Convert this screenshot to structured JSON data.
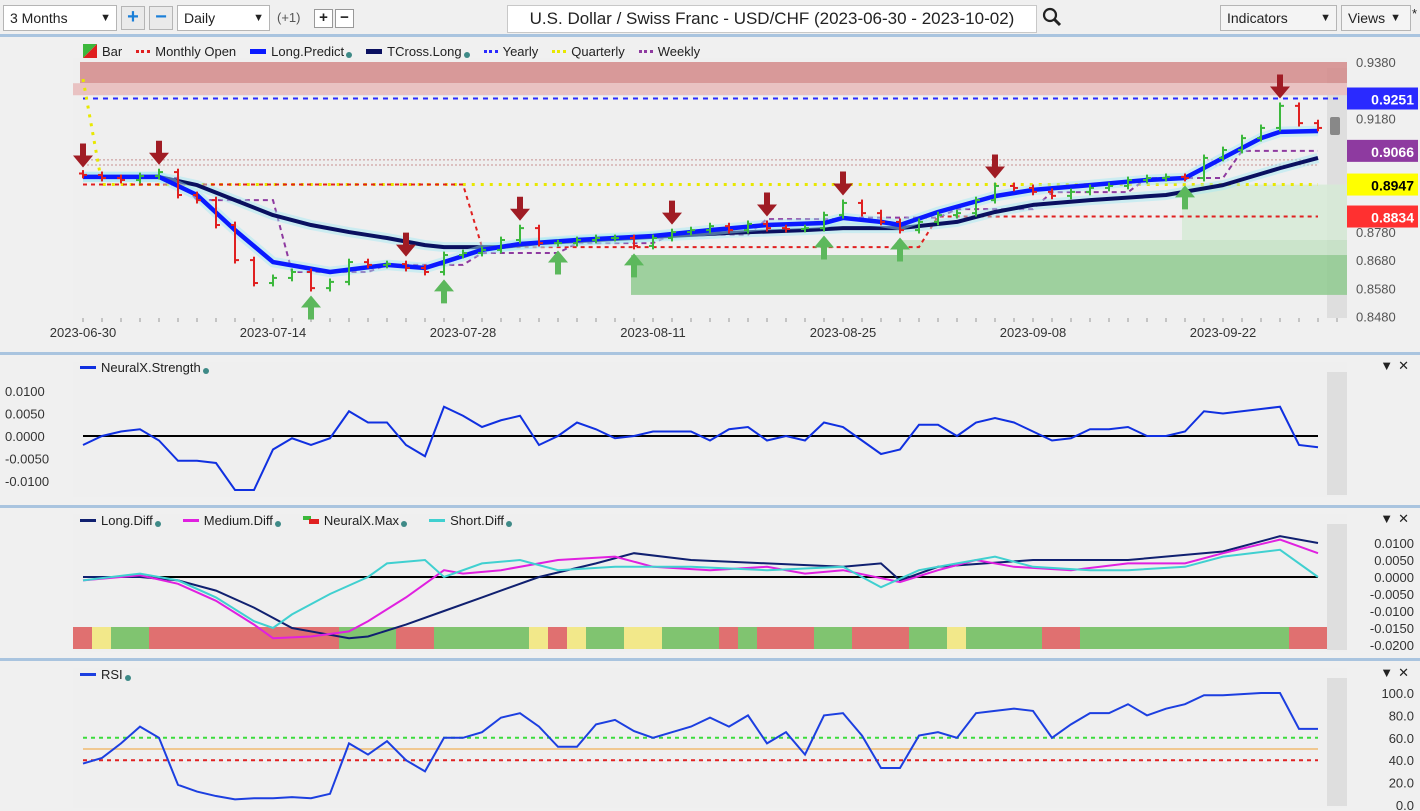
{
  "toolbar": {
    "period": "3 Months",
    "interval": "Daily",
    "offset": "(+1)",
    "title": "U.S. Dollar / Swiss Franc - USD/CHF (2023-06-30 - 2023-10-02)",
    "indicators": "Indicators",
    "views": "Views",
    "views_mark": "*"
  },
  "icons": {
    "zoom_in": "+",
    "zoom_out": "−",
    "search": "search-icon",
    "dropdown": "▼",
    "close": "✕"
  },
  "main_legend": [
    "Bar",
    "Monthly Open",
    "Long.Predict",
    "TCross.Long",
    "Yearly",
    "Quarterly",
    "Weekly"
  ],
  "panel2_legend": [
    "NeuralX.Strength"
  ],
  "panel3_legend": [
    "Long.Diff",
    "Medium.Diff",
    "NeuralX.Max",
    "Short.Diff"
  ],
  "panel4_legend": [
    "RSI"
  ],
  "colors": {
    "up": "#3cb83c",
    "down": "#e02020",
    "long_predict": "#0a1aff",
    "tcross": "#0a1060",
    "yearly": "#2a2aff",
    "quarterly": "#e8e800",
    "weekly": "#8e3aa0",
    "monthly": "#e02020",
    "strength": "#1030e0",
    "long_diff": "#102070",
    "medium_diff": "#e020e0",
    "short_diff": "#40d0d0",
    "rsi": "#1c3fe0"
  },
  "chart_data": [
    {
      "type": "ohlc",
      "frequency": "Daily",
      "x_ticks": [
        "2023-06-30",
        "2023-07-14",
        "2023-07-28",
        "2023-08-11",
        "2023-08-25",
        "2023-09-08",
        "2023-09-22"
      ],
      "ylim": [
        0.848,
        0.938
      ],
      "y_ticks": [
        "0.9380",
        "0.9180",
        "0.8780",
        "0.8680",
        "0.8580",
        "0.8480"
      ],
      "close": [
        0.8981,
        0.897,
        0.8963,
        0.8977,
        0.8991,
        0.891,
        0.8892,
        0.8804,
        0.868,
        0.8599,
        0.8617,
        0.8638,
        0.8581,
        0.8603,
        0.8673,
        0.8663,
        0.8666,
        0.8652,
        0.8638,
        0.8698,
        0.8705,
        0.8716,
        0.8751,
        0.8793,
        0.874,
        0.874,
        0.8751,
        0.8758,
        0.8758,
        0.873,
        0.8758,
        0.8779,
        0.8786,
        0.88,
        0.8786,
        0.8808,
        0.8793,
        0.879,
        0.8793,
        0.8839,
        0.8882,
        0.8846,
        0.8815,
        0.8786,
        0.8815,
        0.8839,
        0.8846,
        0.8892,
        0.8942,
        0.8935,
        0.8921,
        0.8907,
        0.8921,
        0.8935,
        0.8942,
        0.8963,
        0.897,
        0.8974,
        0.897,
        0.9041,
        0.9069,
        0.9111,
        0.9147,
        0.9225,
        0.9164,
        0.9147
      ],
      "long_predict": [
        [
          "2023-06-30",
          0.8974
        ],
        [
          "2023-07-06",
          0.8974
        ],
        [
          "2023-07-10",
          0.891
        ],
        [
          "2023-07-12",
          0.8786
        ],
        [
          "2023-07-14",
          0.8673
        ],
        [
          "2023-07-19",
          0.8638
        ],
        [
          "2023-07-24",
          0.8663
        ],
        [
          "2023-07-26",
          0.8652
        ],
        [
          "2023-07-27",
          0.8673
        ],
        [
          "2023-07-31",
          0.8716
        ],
        [
          "2023-08-02",
          0.8737
        ],
        [
          "2023-08-07",
          0.8751
        ],
        [
          "2023-08-11",
          0.8765
        ],
        [
          "2023-08-16",
          0.8786
        ],
        [
          "2023-08-21",
          0.8804
        ],
        [
          "2023-08-24",
          0.8811
        ],
        [
          "2023-08-25",
          0.8829
        ],
        [
          "2023-08-29",
          0.8815
        ],
        [
          "2023-08-30",
          0.8804
        ],
        [
          "2023-09-01",
          0.885
        ],
        [
          "2023-09-06",
          0.8906
        ],
        [
          "2023-09-08",
          0.8928
        ],
        [
          "2023-09-13",
          0.8945
        ],
        [
          "2023-09-18",
          0.8963
        ],
        [
          "2023-09-20",
          0.897
        ],
        [
          "2023-09-22",
          0.9041
        ],
        [
          "2023-09-26",
          0.9111
        ],
        [
          "2023-09-27",
          0.9133
        ],
        [
          "2023-09-29",
          0.9136
        ]
      ],
      "tcross_long": [
        [
          "2023-06-30",
          0.8974
        ],
        [
          "2023-07-06",
          0.8974
        ],
        [
          "2023-07-10",
          0.8945
        ],
        [
          "2023-07-12",
          0.8892
        ],
        [
          "2023-07-14",
          0.8839
        ],
        [
          "2023-07-18",
          0.8804
        ],
        [
          "2023-07-20",
          0.8779
        ],
        [
          "2023-07-24",
          0.8758
        ],
        [
          "2023-07-26",
          0.8733
        ],
        [
          "2023-07-27",
          0.8726
        ],
        [
          "2023-08-01",
          0.8726
        ],
        [
          "2023-08-03",
          0.874
        ],
        [
          "2023-08-08",
          0.8751
        ],
        [
          "2023-08-11",
          0.8762
        ],
        [
          "2023-08-17",
          0.8776
        ],
        [
          "2023-08-23",
          0.8786
        ],
        [
          "2023-08-25",
          0.8793
        ],
        [
          "2023-08-30",
          0.8793
        ],
        [
          "2023-09-04",
          0.8815
        ],
        [
          "2023-09-06",
          0.885
        ],
        [
          "2023-09-08",
          0.8875
        ],
        [
          "2023-09-13",
          0.8892
        ],
        [
          "2023-09-19",
          0.891
        ],
        [
          "2023-09-22",
          0.8945
        ],
        [
          "2023-09-27",
          0.9005
        ],
        [
          "2023-09-29",
          0.9041
        ]
      ],
      "yearly": 0.9251,
      "quarterly": [
        [
          "2023-06-30",
          0.932
        ],
        [
          "2023-07-03",
          0.8947
        ],
        [
          "2023-09-29",
          0.8947
        ]
      ],
      "monthly_open": [
        [
          "2023-06-30",
          "2023-07-28",
          0.8947
        ],
        [
          "2023-07-31",
          "2023-08-31",
          0.8726
        ],
        [
          "2023-09-01",
          "2023-09-29",
          0.8834
        ]
      ],
      "weekly": [
        [
          "2023-07-03",
          "2023-07-07",
          0.897
        ],
        [
          "2023-07-10",
          "2023-07-14",
          0.8892
        ],
        [
          "2023-07-17",
          "2023-07-21",
          0.8638
        ],
        [
          "2023-07-24",
          "2023-07-28",
          0.8663
        ],
        [
          "2023-07-31",
          "2023-08-04",
          0.8705
        ],
        [
          "2023-08-07",
          "2023-08-11",
          0.874
        ],
        [
          "2023-08-14",
          "2023-08-18",
          0.877
        ],
        [
          "2023-08-21",
          "2023-08-25",
          0.8825
        ],
        [
          "2023-08-28",
          "2023-09-01",
          0.883
        ],
        [
          "2023-09-04",
          "2023-09-08",
          0.886
        ],
        [
          "2023-09-11",
          "2023-09-15",
          0.892
        ],
        [
          "2023-09-18",
          "2023-09-22",
          0.897
        ],
        [
          "2023-09-25",
          "2023-09-29",
          0.9066
        ]
      ],
      "level_labels": [
        {
          "value": "0.9251",
          "color": "#2a2aff",
          "text_color": "#ffffff"
        },
        {
          "value": "0.9066",
          "color": "#8e3aa0",
          "text_color": "#ffffff"
        },
        {
          "value": "0.8947",
          "color": "#ffff00",
          "text_color": "#000000"
        },
        {
          "value": "0.8834",
          "color": "#ff3030",
          "text_color": "#ffffff"
        }
      ],
      "down_signals": [
        "2023-06-30",
        "2023-07-06",
        "2023-07-25",
        "2023-08-02",
        "2023-08-14",
        "2023-08-21",
        "2023-08-25",
        "2023-09-06",
        "2023-09-27"
      ],
      "up_signals": [
        "2023-07-18",
        "2023-07-27",
        "2023-08-04",
        "2023-08-10",
        "2023-08-24",
        "2023-08-30",
        "2023-09-20"
      ],
      "zones": [
        {
          "from": "2023-06-30",
          "low": 0.9305,
          "high": 0.938,
          "color": "#d48a8a"
        },
        {
          "from": "2023-08-10",
          "low": 0.8557,
          "high": 0.8698,
          "color": "#8fca8f"
        },
        {
          "from": "2023-08-30",
          "low": 0.8698,
          "high": 0.8751,
          "color": "#c4e2c4"
        },
        {
          "from": "2023-09-20",
          "low": 0.8751,
          "high": 0.8947,
          "color": "#d6ead6"
        }
      ]
    },
    {
      "type": "line",
      "series": [
        {
          "name": "NeuralX.Strength",
          "values": [
            -0.002,
            0,
            0.001,
            0.0015,
            -0.001,
            -0.0055,
            -0.0055,
            -0.006,
            -0.012,
            -0.012,
            -0.003,
            -0.0005,
            -0.002,
            -0.0005,
            0.0055,
            0.003,
            0.003,
            -0.002,
            -0.0045,
            0.0065,
            0.0045,
            0.002,
            0.0035,
            0.0045,
            -0.002,
            0,
            0.003,
            0.0015,
            -0.0005,
            0,
            0.001,
            0.001,
            0.001,
            -0.001,
            0.0015,
            0.002,
            -0.001,
            0,
            -0.001,
            0.003,
            0.002,
            -0.001,
            -0.004,
            -0.003,
            0.0025,
            0.0025,
            0,
            0.003,
            0.004,
            0.003,
            0.001,
            -0.001,
            -0.0005,
            0.0015,
            0.0015,
            0.002,
            0,
            0,
            0.001,
            0.0055,
            0.005,
            0.0055,
            0.006,
            0.0065,
            -0.002,
            -0.0025
          ]
        }
      ],
      "ylim": [
        -0.0125,
        0.0125
      ],
      "y_ticks": [
        "0.0100",
        "0.0050",
        "0.0000",
        "-0.0050",
        "-0.0100"
      ]
    },
    {
      "type": "line",
      "series": [
        {
          "name": "Long.Diff",
          "points": [
            [
              0,
              0
            ],
            [
              3,
              0
            ],
            [
              5,
              -0.001
            ],
            [
              7,
              -0.004
            ],
            [
              9,
              -0.009
            ],
            [
              11,
              -0.015
            ],
            [
              13,
              -0.017
            ],
            [
              14,
              -0.018
            ],
            [
              15,
              -0.0175
            ],
            [
              17,
              -0.014
            ],
            [
              19,
              -0.01
            ],
            [
              21,
              -0.006
            ],
            [
              22,
              -0.004
            ],
            [
              24,
              0
            ],
            [
              27,
              0.004
            ],
            [
              29,
              0.007
            ],
            [
              32,
              0.005
            ],
            [
              36,
              0.004
            ],
            [
              40,
              0.003
            ],
            [
              42,
              0.004
            ],
            [
              43,
              -0.001
            ],
            [
              45,
              0.003
            ],
            [
              50,
              0.005
            ],
            [
              55,
              0.005
            ],
            [
              58,
              0.0065
            ],
            [
              60,
              0.0075
            ],
            [
              63,
              0.012
            ],
            [
              65,
              0.01
            ]
          ]
        },
        {
          "name": "Medium.Diff",
          "points": [
            [
              0,
              -0.001
            ],
            [
              3,
              0.0005
            ],
            [
              5,
              -0.002
            ],
            [
              7,
              -0.007
            ],
            [
              9,
              -0.014
            ],
            [
              10,
              -0.018
            ],
            [
              12,
              -0.0175
            ],
            [
              14,
              -0.016
            ],
            [
              15,
              -0.013
            ],
            [
              17,
              -0.006
            ],
            [
              18,
              -0.002
            ],
            [
              19,
              0.002
            ],
            [
              20,
              0.001
            ],
            [
              22,
              0.002
            ],
            [
              25,
              0.005
            ],
            [
              28,
              0.006
            ],
            [
              30,
              0.003
            ],
            [
              33,
              0.002
            ],
            [
              36,
              0.003
            ],
            [
              38,
              0.001
            ],
            [
              40,
              0.002
            ],
            [
              43,
              -0.0015
            ],
            [
              45,
              0.002
            ],
            [
              47,
              0.005
            ],
            [
              49,
              0.003
            ],
            [
              52,
              0.002
            ],
            [
              55,
              0.004
            ],
            [
              58,
              0.004
            ],
            [
              60,
              0.007
            ],
            [
              63,
              0.011
            ],
            [
              65,
              0.007
            ]
          ]
        },
        {
          "name": "Short.Diff",
          "points": [
            [
              0,
              -0.001
            ],
            [
              3,
              0.001
            ],
            [
              5,
              -0.001
            ],
            [
              7,
              -0.006
            ],
            [
              9,
              -0.013
            ],
            [
              10,
              -0.015
            ],
            [
              11,
              -0.011
            ],
            [
              13,
              -0.005
            ],
            [
              15,
              0
            ],
            [
              16,
              0.004
            ],
            [
              18,
              0.005
            ],
            [
              19,
              0
            ],
            [
              21,
              0.004
            ],
            [
              23,
              0.005
            ],
            [
              25,
              0.002
            ],
            [
              28,
              0.003
            ],
            [
              32,
              0.003
            ],
            [
              36,
              0.002
            ],
            [
              40,
              0.003
            ],
            [
              42,
              -0.003
            ],
            [
              44,
              0.002
            ],
            [
              46,
              0.004
            ],
            [
              48,
              0.006
            ],
            [
              50,
              0.003
            ],
            [
              53,
              0.002
            ],
            [
              55,
              0.002
            ],
            [
              58,
              0.003
            ],
            [
              60,
              0.006
            ],
            [
              63,
              0.008
            ],
            [
              65,
              0
            ]
          ]
        }
      ],
      "neuralx_max": [
        [
          "red",
          1
        ],
        [
          "yellow",
          1
        ],
        [
          "green",
          2
        ],
        [
          "red",
          10
        ],
        [
          "green",
          3
        ],
        [
          "red",
          2
        ],
        [
          "green",
          5
        ],
        [
          "yellow",
          1
        ],
        [
          "red",
          1
        ],
        [
          "yellow",
          1
        ],
        [
          "green",
          2
        ],
        [
          "yellow",
          2
        ],
        [
          "green",
          3
        ],
        [
          "red",
          1
        ],
        [
          "green",
          1
        ],
        [
          "red",
          3
        ],
        [
          "green",
          2
        ],
        [
          "red",
          3
        ],
        [
          "green",
          2
        ],
        [
          "yellow",
          1
        ],
        [
          "green",
          4
        ],
        [
          "red",
          2
        ],
        [
          "green",
          11
        ],
        [
          "red",
          2
        ]
      ],
      "ylim": [
        -0.0215,
        0.0125
      ],
      "y_ticks": [
        "0.0100",
        "0.0050",
        "0.0000",
        "-0.0050",
        "-0.0100",
        "-0.0150",
        "-0.0200"
      ]
    },
    {
      "type": "line",
      "series": [
        {
          "name": "RSI",
          "values": [
            37,
            42,
            55,
            70,
            60,
            18,
            12,
            8,
            5,
            6,
            6,
            7,
            6,
            10,
            55,
            45,
            57,
            40,
            30,
            60,
            60,
            65,
            78,
            82,
            70,
            52,
            52,
            72,
            76,
            66,
            60,
            65,
            70,
            78,
            70,
            80,
            55,
            65,
            45,
            80,
            82,
            62,
            33,
            33,
            62,
            65,
            60,
            82,
            84,
            86,
            84,
            60,
            72,
            82,
            82,
            90,
            80,
            86,
            90,
            98,
            98,
            99,
            100,
            100,
            68,
            68
          ]
        }
      ],
      "levels": [
        60,
        50,
        40
      ],
      "ylim": [
        0,
        100
      ],
      "y_ticks": [
        "100.0",
        "80.0",
        "60.0",
        "40.0",
        "20.0",
        "0.0"
      ]
    }
  ]
}
